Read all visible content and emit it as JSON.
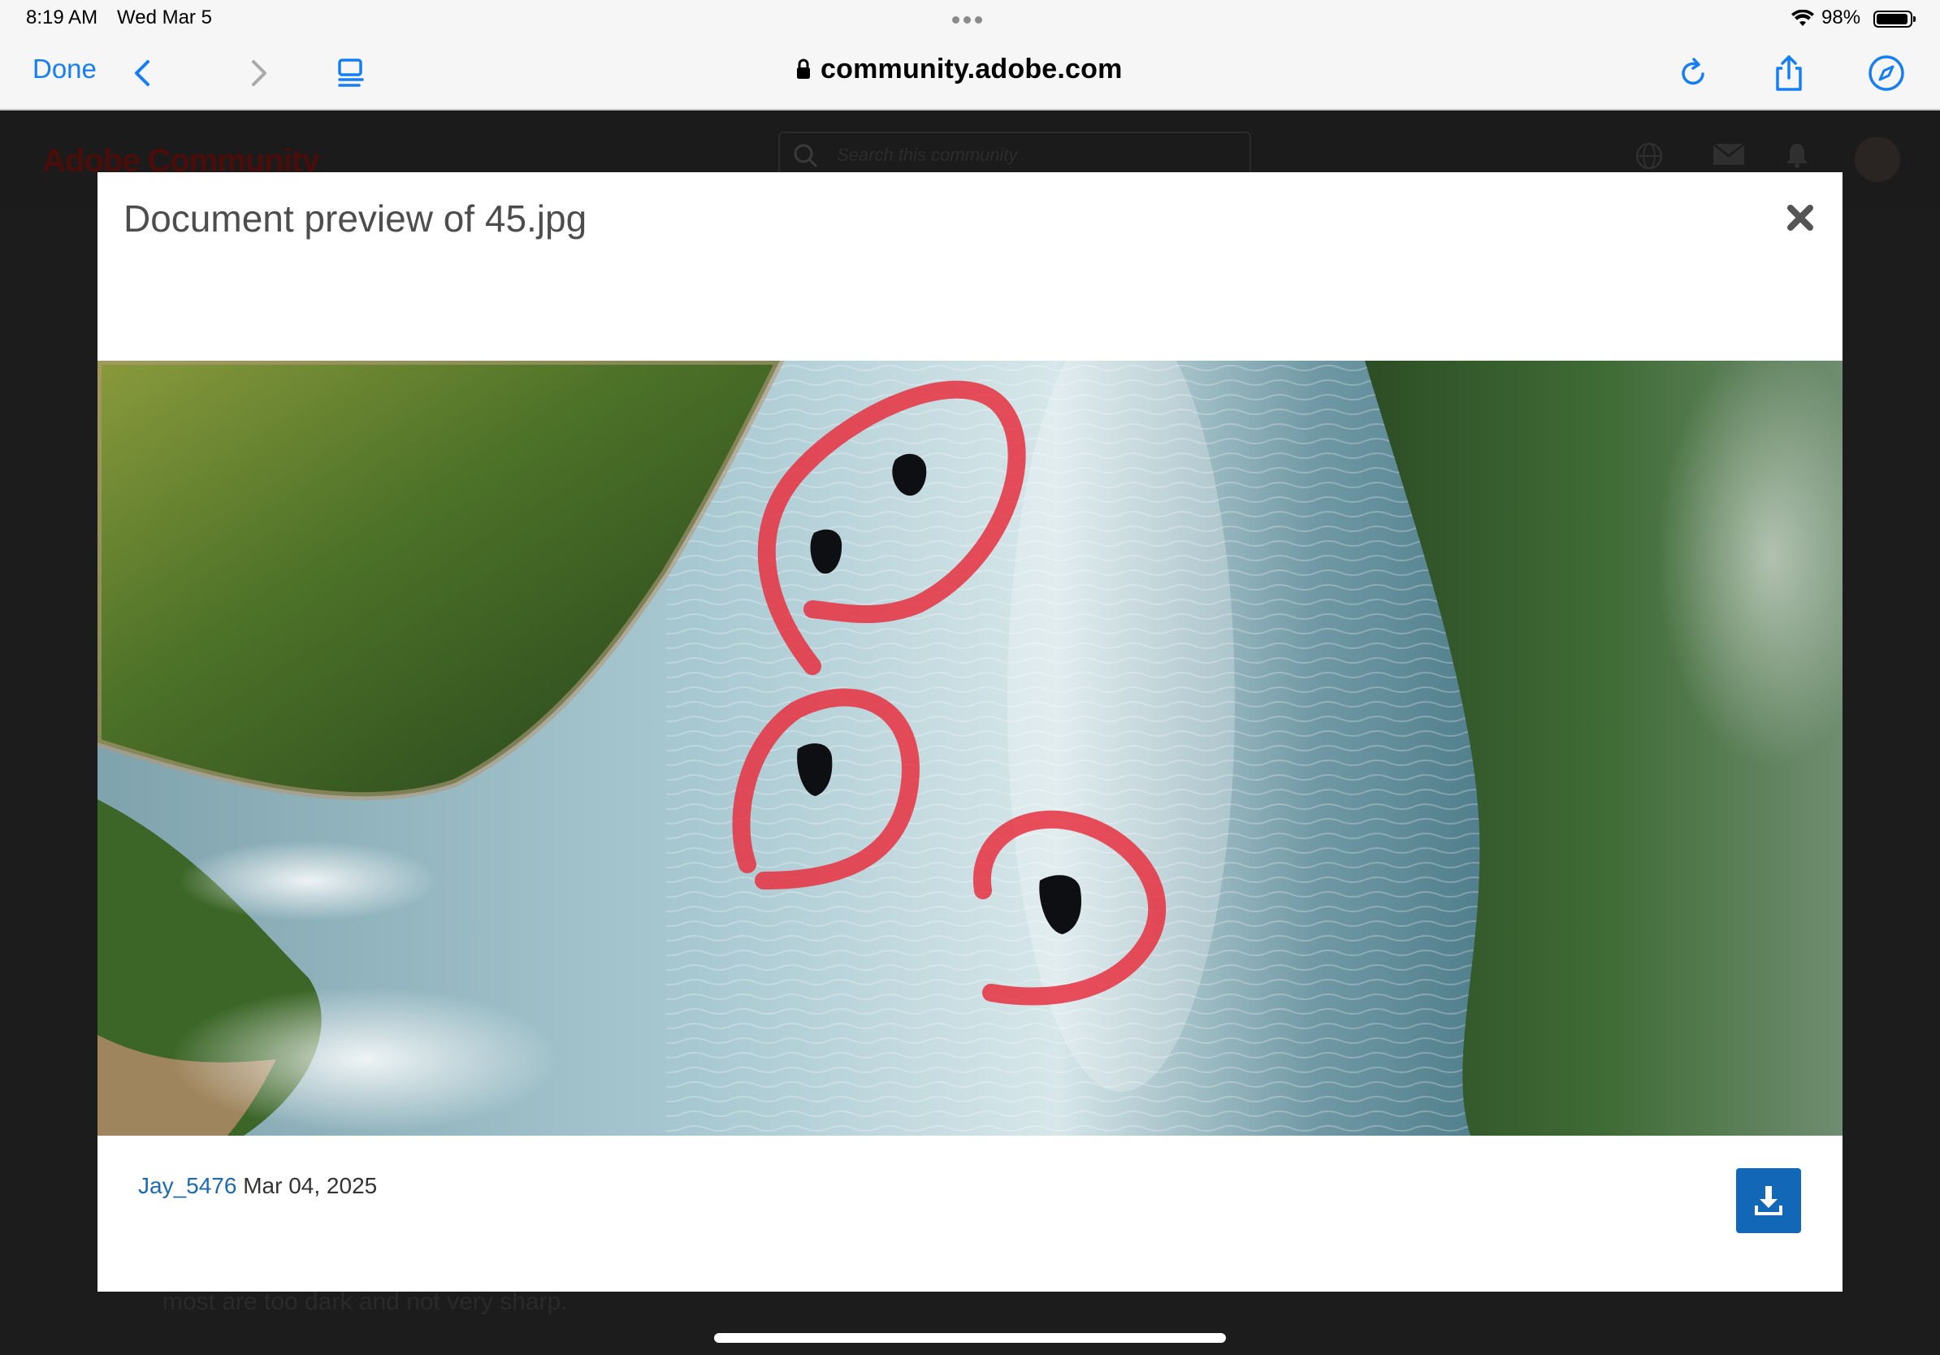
{
  "status_bar": {
    "time": "8:19 AM",
    "date": "Wed Mar 5",
    "battery": "98%"
  },
  "browser": {
    "done_label": "Done",
    "url": "community.adobe.com",
    "icons": [
      "back-icon",
      "forward-icon",
      "reader-icon",
      "reload-icon",
      "share-icon",
      "compass-icon"
    ]
  },
  "page": {
    "logo": "Adobe Community",
    "search_placeholder": "Search this community",
    "background_text": "most are too dark and not very sharp."
  },
  "modal": {
    "title": "Document preview of 45.jpg",
    "author": "Jay_5476",
    "date": "Mar 04, 2025",
    "image_alt": "45.jpg"
  },
  "colors": {
    "accent": "#167ef5",
    "author_link": "#1c6bb0",
    "download_button": "#1267b6",
    "annotation": "#e8303f"
  }
}
